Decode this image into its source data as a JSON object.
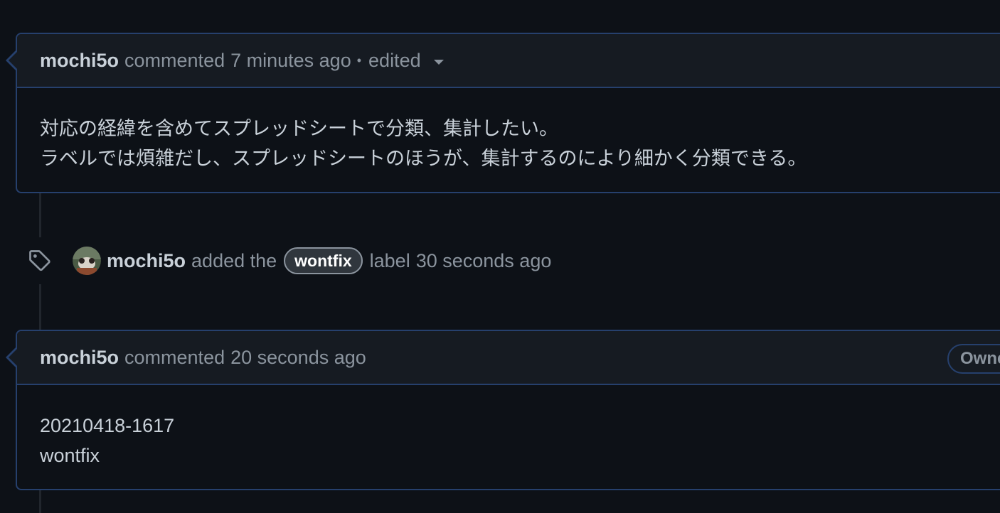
{
  "timeline": {
    "comment1": {
      "author": "mochi5o",
      "action": "commented",
      "time": "7 minutes ago",
      "separator": "•",
      "edited": "edited",
      "body": [
        "対応の経緯を含めてスプレッドシートで分類、集計したい。",
        "ラベルでは煩雑だし、スプレッドシートのほうが、集計するのにより細かく分類できる。"
      ]
    },
    "event": {
      "icon": "tag-icon",
      "author": "mochi5o",
      "text_before": "added the",
      "label": "wontfix",
      "text_after": "label",
      "time": "30 seconds ago"
    },
    "comment2": {
      "author": "mochi5o",
      "action": "commented",
      "time": "20 seconds ago",
      "badge": "Owne",
      "body": [
        "20210418-1617",
        "wontfix"
      ]
    }
  },
  "colors": {
    "background": "#0d1117",
    "header": "#161b22",
    "border": "#26406d",
    "muted": "#8b949e",
    "text": "#c9d1d9"
  }
}
